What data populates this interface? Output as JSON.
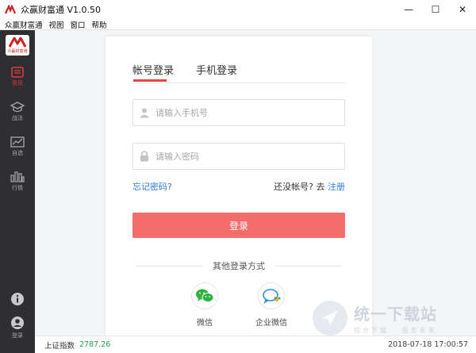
{
  "window": {
    "title": "众赢财富通 V1.0.50",
    "minimize": "—",
    "maximize": "☐",
    "close": "✕"
  },
  "menu": [
    "众赢财富通",
    "视图",
    "窗口",
    "帮助"
  ],
  "logo": {
    "sub": "众赢财富通"
  },
  "sidebar": {
    "items": [
      {
        "label": "资讯",
        "icon": "news-icon",
        "active": true
      },
      {
        "label": "战法",
        "icon": "graduation-cap-icon",
        "active": false
      },
      {
        "label": "自选",
        "icon": "trend-chart-icon",
        "active": false
      },
      {
        "label": "行情",
        "icon": "bar-chart-icon",
        "active": false
      }
    ],
    "bottom": [
      {
        "label": "",
        "icon": "info-icon"
      },
      {
        "label": "登录",
        "icon": "user-icon"
      }
    ]
  },
  "login": {
    "tabs": [
      {
        "label": "帐号登录",
        "active": true
      },
      {
        "label": "手机登录",
        "active": false
      }
    ],
    "phone_placeholder": "请输入手机号",
    "password_placeholder": "请输入密码",
    "forgot": "忘记密码?",
    "no_account": "还没帐号? 去",
    "register": "注册",
    "submit": "登录",
    "other_methods": "其他登录方式",
    "social": [
      {
        "label": "微信",
        "icon": "wechat-icon"
      },
      {
        "label": "企业微信",
        "icon": "wecom-icon"
      }
    ]
  },
  "statusbar": {
    "index_label": "上证指数",
    "index_value": "2787.26",
    "time": "2018-07-18 17:00:57"
  },
  "watermark": {
    "main": "统一下载站",
    "sub": "综合下载 · 服务未来"
  },
  "colors": {
    "accent": "#e8413f",
    "button": "#f46d6c",
    "link": "#2c7fd7",
    "sidebar": "#2f2f33",
    "up": "#23a04a"
  }
}
